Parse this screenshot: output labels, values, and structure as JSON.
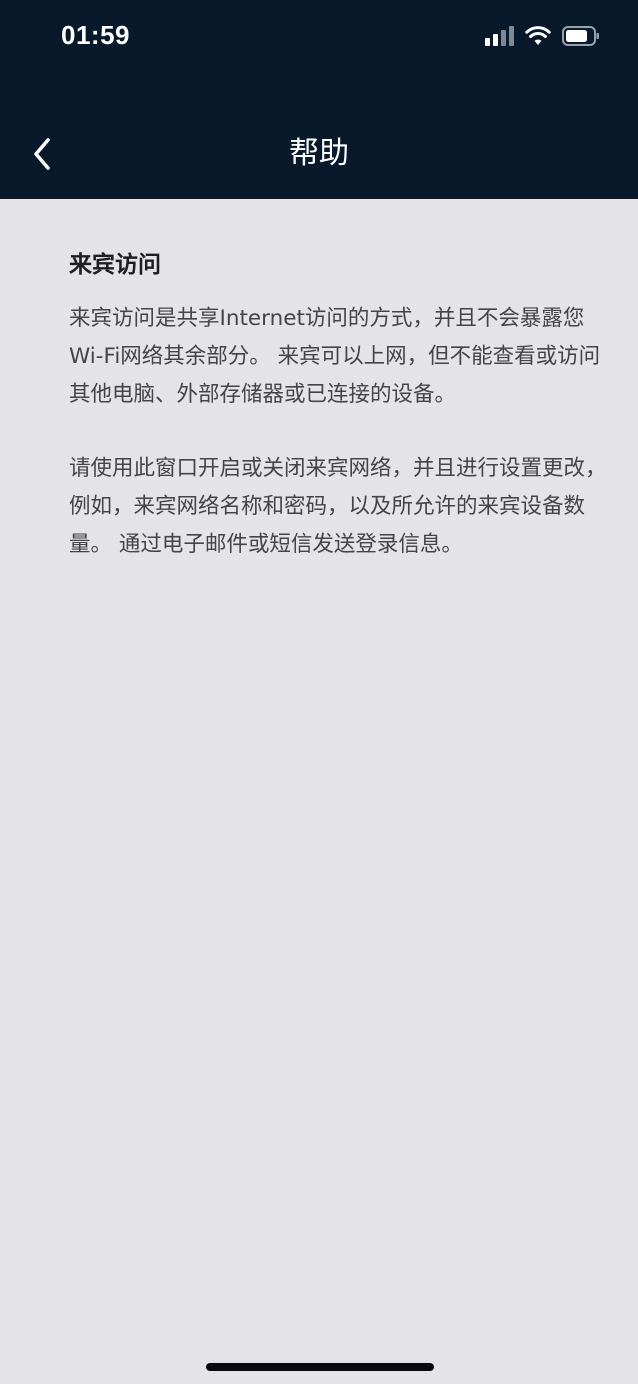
{
  "status_bar": {
    "time": "01:59",
    "icons": [
      "cellular-signal-icon",
      "wifi-icon",
      "battery-icon"
    ]
  },
  "nav": {
    "title": "帮助",
    "back_icon": "chevron-left-icon"
  },
  "content": {
    "title": "来宾访问",
    "paragraphs": [
      "来宾访问是共享Internet访问的方式，并且不会暴露您Wi-Fi网络其余部分。 来宾可以上网，但不能查看或访问其他电脑、外部存储器或已连接的设备。",
      "请使用此窗口开启或关闭来宾网络，并且进行设置更改，例如，来宾网络名称和密码，以及所允许的来宾设备数量。 通过电子邮件或短信发送登录信息。"
    ]
  },
  "colors": {
    "header_bg": "#07192a",
    "page_bg": "#e4e4e6",
    "text": "#444446",
    "title_text": "#1f1f21"
  }
}
